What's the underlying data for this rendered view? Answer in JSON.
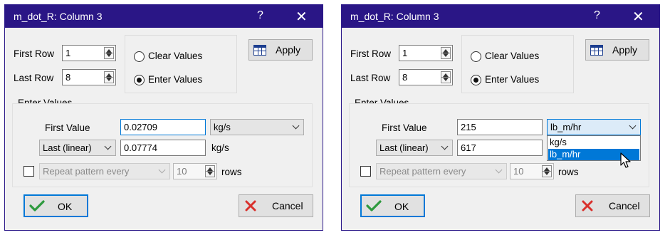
{
  "dialogs": [
    {
      "title": "m_dot_R:  Column 3",
      "help_glyph": "?",
      "close_glyph": "✕",
      "first_row_label": "First Row",
      "first_row_value": "1",
      "last_row_label": "Last Row",
      "last_row_value": "8",
      "clear_values_label": "Clear Values",
      "enter_values_radio_label": "Enter Values",
      "selected_mode": "Enter Values",
      "apply_label": "Apply",
      "enter_values_group_label": "Enter Values",
      "first_value_label": "First Value",
      "first_value": "0.02709",
      "first_unit": "kg/s",
      "last_mode": "Last (linear)",
      "last_value": "0.07774",
      "last_unit": "kg/s",
      "repeat_label": "Repeat pattern every",
      "repeat_count": "10",
      "rows_label": "rows",
      "ok_label": "OK",
      "cancel_label": "Cancel"
    },
    {
      "title": "m_dot_R:  Column 3",
      "help_glyph": "?",
      "close_glyph": "✕",
      "first_row_label": "First Row",
      "first_row_value": "1",
      "last_row_label": "Last Row",
      "last_row_value": "8",
      "clear_values_label": "Clear Values",
      "enter_values_radio_label": "Enter Values",
      "selected_mode": "Enter Values",
      "apply_label": "Apply",
      "enter_values_group_label": "Enter Values",
      "first_value_label": "First Value",
      "first_value": "215",
      "first_unit": "lb_m/hr",
      "unit_options": [
        "kg/s",
        "lb_m/hr"
      ],
      "highlighted_option": "lb_m/hr",
      "last_mode": "Last (linear)",
      "last_value": "617",
      "repeat_label": "Repeat pattern every",
      "repeat_count": "10",
      "rows_label": "rows",
      "ok_label": "OK",
      "cancel_label": "Cancel"
    }
  ],
  "colors": {
    "titlebar": "#2a1686",
    "dialog_bg": "#f0f0f0",
    "focus_blue": "#0078d7",
    "ok_check_green": "#2e9a3e",
    "cancel_x_red": "#d9302c"
  }
}
